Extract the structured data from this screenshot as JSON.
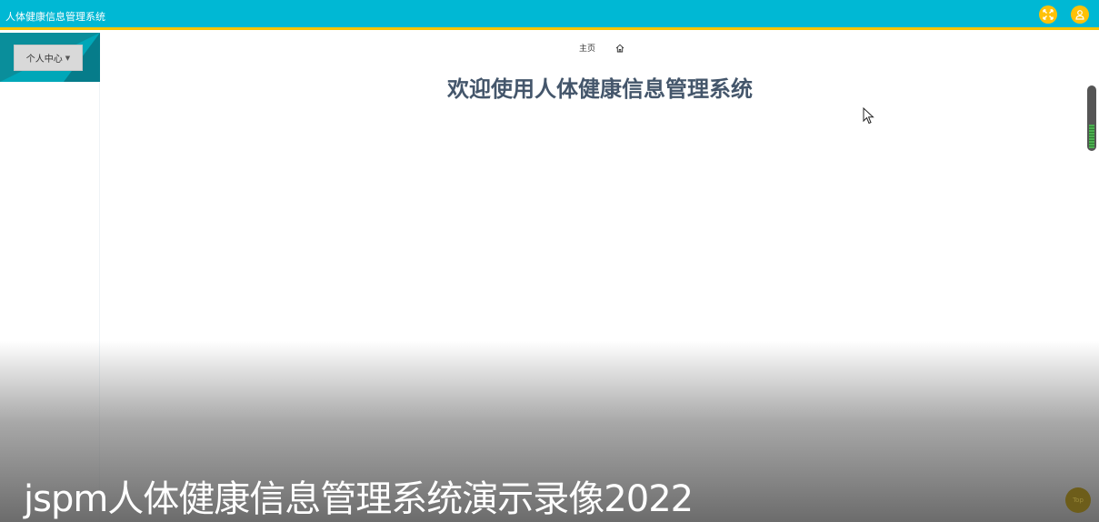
{
  "header": {
    "title": "人体健康信息管理系统",
    "icons": [
      "expand-icon",
      "user-icon"
    ],
    "colors": {
      "bar": "#00b8d4",
      "accent": "#f5c400",
      "icon_bg": "#ffc107"
    }
  },
  "sidebar": {
    "personal_center_label": "个人中心"
  },
  "breadcrumb": {
    "home_label": "主页",
    "home_icon": "home-icon"
  },
  "main": {
    "welcome_title": "欢迎使用人体健康信息管理系统"
  },
  "overlay": {
    "caption": "jspm人体健康信息管理系统演示录像2022",
    "top_button_label": "Top"
  }
}
